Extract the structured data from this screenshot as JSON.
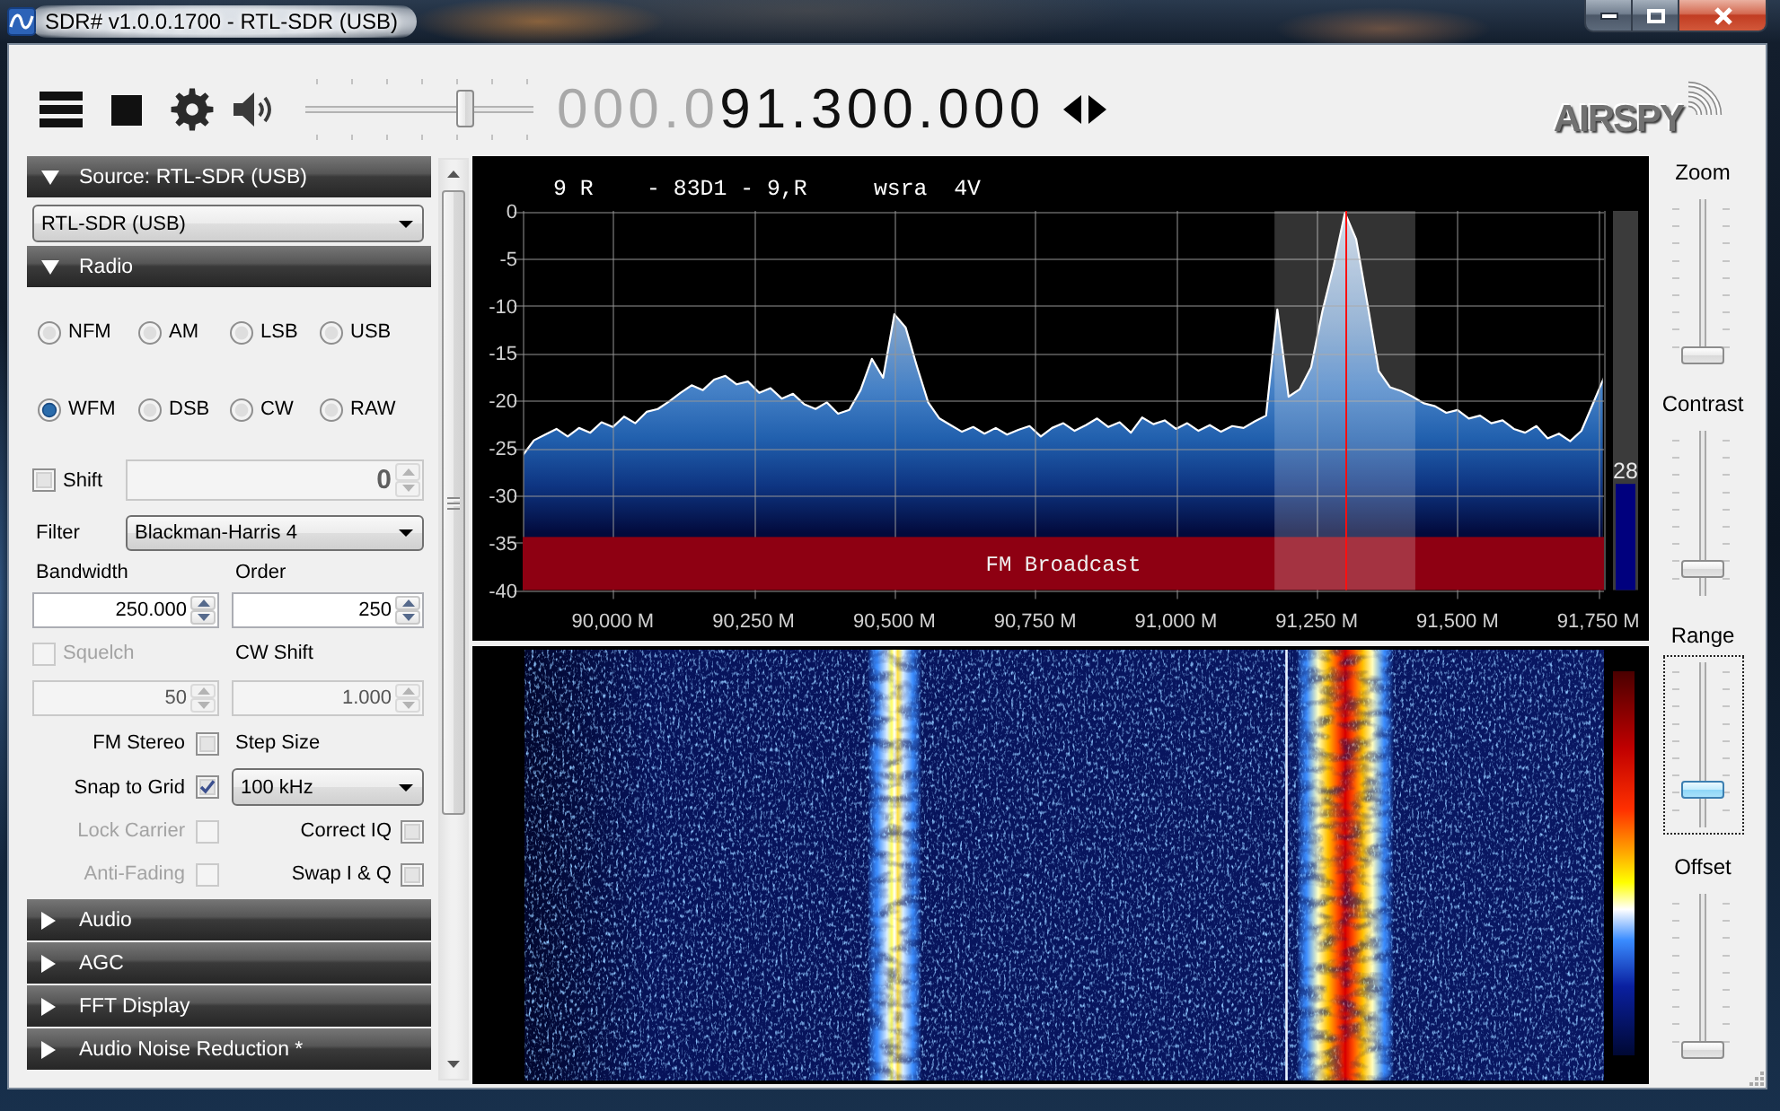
{
  "window": {
    "title": "SDR# v1.0.0.1700 - RTL-SDR (USB)"
  },
  "toolbar": {
    "volume": {
      "level": 0.72
    },
    "frequency_prefix": "000.0",
    "frequency": "91.300.000",
    "logo": "AIRSPY"
  },
  "panels": [
    {
      "kind": "source",
      "title": "Source: RTL-SDR (USB)",
      "expanded": true,
      "device": "RTL-SDR (USB)"
    },
    {
      "kind": "radio",
      "title": "Radio",
      "expanded": true,
      "modes": [
        {
          "label": "NFM",
          "selected": false
        },
        {
          "label": "AM",
          "selected": false
        },
        {
          "label": "LSB",
          "selected": false
        },
        {
          "label": "USB",
          "selected": false
        },
        {
          "label": "WFM",
          "selected": true
        },
        {
          "label": "DSB",
          "selected": false
        },
        {
          "label": "CW",
          "selected": false
        },
        {
          "label": "RAW",
          "selected": false
        }
      ],
      "shift": {
        "label": "Shift",
        "checked": false,
        "disabled": false,
        "field": {
          "value": "0",
          "disabled": true
        }
      },
      "filter": {
        "label": "Filter",
        "value": "Blackman-Harris 4"
      },
      "bandwidth": {
        "label": "Bandwidth",
        "field": {
          "value": "250.000",
          "disabled": false
        }
      },
      "order": {
        "label": "Order",
        "field": {
          "value": "250",
          "disabled": false
        }
      },
      "squelch": {
        "label": "Squelch",
        "checked": false,
        "disabled": true,
        "field": {
          "value": "50",
          "disabled": true
        }
      },
      "cw_shift": {
        "label": "CW Shift",
        "field": {
          "value": "1.000",
          "disabled": true
        }
      },
      "left_options": [
        {
          "label": "FM Stereo",
          "checked": false,
          "disabled": false
        },
        {
          "label": "Snap to Grid",
          "checked": true,
          "disabled": false
        },
        {
          "label": "Lock Carrier",
          "checked": false,
          "disabled": true
        },
        {
          "label": "Anti-Fading",
          "checked": false,
          "disabled": true
        }
      ],
      "step_size": {
        "label": "Step Size",
        "value": "100 kHz"
      },
      "right_options": [
        {
          "label": "Correct IQ",
          "checked": false,
          "disabled": false
        },
        {
          "label": "Swap I & Q",
          "checked": false,
          "disabled": false
        }
      ]
    },
    {
      "kind": "section",
      "title": "Audio",
      "expanded": false
    },
    {
      "kind": "section",
      "title": "AGC",
      "expanded": false
    },
    {
      "kind": "section",
      "title": "FFT Display",
      "expanded": false
    },
    {
      "kind": "section",
      "title": "Audio Noise Reduction *",
      "expanded": false
    }
  ],
  "spectrum": {
    "rds_text": "9 R    - 83D1 - 9,R     wsra  4V",
    "signal_meter": {
      "level": 0.28,
      "reading": "28"
    },
    "chart_data": {
      "type": "area",
      "grid": true,
      "xlim": [
        89840,
        91760
      ],
      "ylim": [
        -40,
        0
      ],
      "xticks": [
        {
          "value": 90000,
          "label": "90,000 M"
        },
        {
          "value": 90250,
          "label": "90,250 M"
        },
        {
          "value": 90500,
          "label": "90,500 M"
        },
        {
          "value": 90750,
          "label": "90,750 M"
        },
        {
          "value": 91000,
          "label": "91,000 M"
        },
        {
          "value": 91250,
          "label": "91,250 M"
        },
        {
          "value": 91500,
          "label": "91,500 M"
        },
        {
          "value": 91750,
          "label": "91,750 M"
        }
      ],
      "yticks": [
        0,
        -5,
        -10,
        -15,
        -20,
        -25,
        -30,
        -35,
        -40
      ],
      "x": [
        89840,
        89840,
        89860,
        89880,
        89900,
        89920,
        89940,
        89960,
        89980,
        90000,
        90020,
        90040,
        90060,
        90080,
        90100,
        90120,
        90140,
        90160,
        90180,
        90200,
        90220,
        90240,
        90260,
        90280,
        90300,
        90320,
        90340,
        90360,
        90380,
        90400,
        90420,
        90440,
        90460,
        90480,
        90500,
        90520,
        90540,
        90560,
        90580,
        90600,
        90620,
        90640,
        90660,
        90680,
        90700,
        90720,
        90740,
        90760,
        90780,
        90800,
        90820,
        90840,
        90860,
        90880,
        90900,
        90920,
        90940,
        90960,
        90980,
        91000,
        91020,
        91040,
        91060,
        91080,
        91100,
        91120,
        91140,
        91160,
        91180,
        91200,
        91220,
        91240,
        91260,
        91280,
        91300,
        91320,
        91340,
        91360,
        91380,
        91400,
        91420,
        91440,
        91460,
        91480,
        91500,
        91520,
        91540,
        91560,
        91580,
        91600,
        91620,
        91640,
        91660,
        91680,
        91700,
        91720,
        91740,
        91760,
        91760
      ],
      "values": [
        -40,
        -25.8,
        -24.2,
        -23.6,
        -23.0,
        -23.8,
        -22.9,
        -23.4,
        -22.3,
        -22.8,
        -21.7,
        -22.4,
        -21.2,
        -20.9,
        -20.1,
        -19.2,
        -18.4,
        -18.9,
        -17.8,
        -17.4,
        -18.3,
        -18.0,
        -19.2,
        -18.7,
        -19.8,
        -19.3,
        -20.4,
        -20.9,
        -20.2,
        -21.4,
        -21.0,
        -18.9,
        -15.6,
        -17.6,
        -10.9,
        -12.3,
        -16.4,
        -20.2,
        -21.9,
        -22.6,
        -23.3,
        -22.8,
        -23.5,
        -22.9,
        -23.6,
        -23.1,
        -22.7,
        -23.8,
        -22.9,
        -22.4,
        -23.2,
        -22.6,
        -21.9,
        -22.8,
        -22.3,
        -23.4,
        -21.8,
        -22.5,
        -22.1,
        -23.0,
        -22.4,
        -23.2,
        -22.6,
        -23.3,
        -22.7,
        -22.9,
        -22.2,
        -21.6,
        -10.4,
        -19.6,
        -18.8,
        -16.5,
        -10.6,
        -5.8,
        -0.2,
        -3.0,
        -9.8,
        -16.9,
        -18.6,
        -19.0,
        -19.6,
        -20.3,
        -20.6,
        -21.3,
        -21.0,
        -21.9,
        -21.6,
        -22.4,
        -22.1,
        -23.0,
        -23.4,
        -22.7,
        -24.0,
        -23.5,
        -24.3,
        -23.2,
        -20.4,
        -17.6,
        -40
      ],
      "bands": [
        {
          "axis": "y",
          "from": -40,
          "to": -34.4,
          "label": "FM Broadcast"
        },
        {
          "axis": "x",
          "from": 91175,
          "to": 91425
        }
      ],
      "ref_lines": [
        {
          "axis": "x",
          "value": 91300
        }
      ]
    }
  },
  "display_sliders": [
    {
      "label": "Zoom",
      "level": 0,
      "focused": false
    },
    {
      "label": "Contrast",
      "level": 0.12,
      "focused": false
    },
    {
      "label": "Range",
      "level": 0.2,
      "focused": true
    },
    {
      "label": "Offset",
      "level": 0,
      "focused": false
    }
  ]
}
